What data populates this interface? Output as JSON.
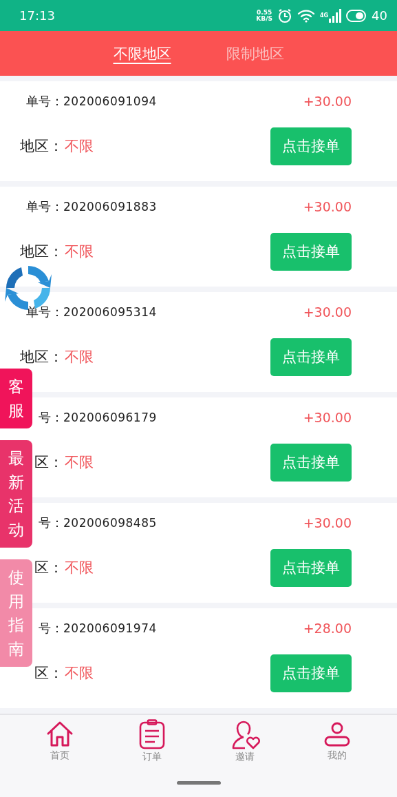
{
  "status_bar": {
    "time": "17:13",
    "speed_value": "0.55",
    "speed_unit": "KB/S",
    "network": "4G",
    "battery": "40"
  },
  "tabs": [
    {
      "label": "不限地区",
      "selected": true
    },
    {
      "label": "限制地区",
      "selected": false
    }
  ],
  "orders": [
    {
      "number_label": "单号：",
      "number": "202006091094",
      "amount": "+30.00",
      "area_label": "地区：",
      "area": "不限",
      "button": "点击接单"
    },
    {
      "number_label": "单号：",
      "number": "202006091883",
      "amount": "+30.00",
      "area_label": "地区：",
      "area": "不限",
      "button": "点击接单"
    },
    {
      "number_label": "单号：",
      "number": "202006095314",
      "amount": "+30.00",
      "area_label": "地区：",
      "area": "不限",
      "button": "点击接单"
    },
    {
      "number_label": "号：",
      "number": "202006096179",
      "amount": "+30.00",
      "area_label": "区：",
      "area": "不限",
      "button": "点击接单"
    },
    {
      "number_label": "号：",
      "number": "202006098485",
      "amount": "+30.00",
      "area_label": "区：",
      "area": "不限",
      "button": "点击接单"
    },
    {
      "number_label": "号：",
      "number": "202006091974",
      "amount": "+28.00",
      "area_label": "区：",
      "area": "不限",
      "button": "点击接单"
    }
  ],
  "float_buttons": [
    {
      "label": "客服",
      "color": "#f0145a"
    },
    {
      "label": "最新活动",
      "color": "#e8336a"
    },
    {
      "label": "使用指南",
      "color": "#f28aa8"
    }
  ],
  "bottom_nav": [
    {
      "label": "首页"
    },
    {
      "label": "订单"
    },
    {
      "label": "邀请"
    },
    {
      "label": "我的"
    }
  ]
}
